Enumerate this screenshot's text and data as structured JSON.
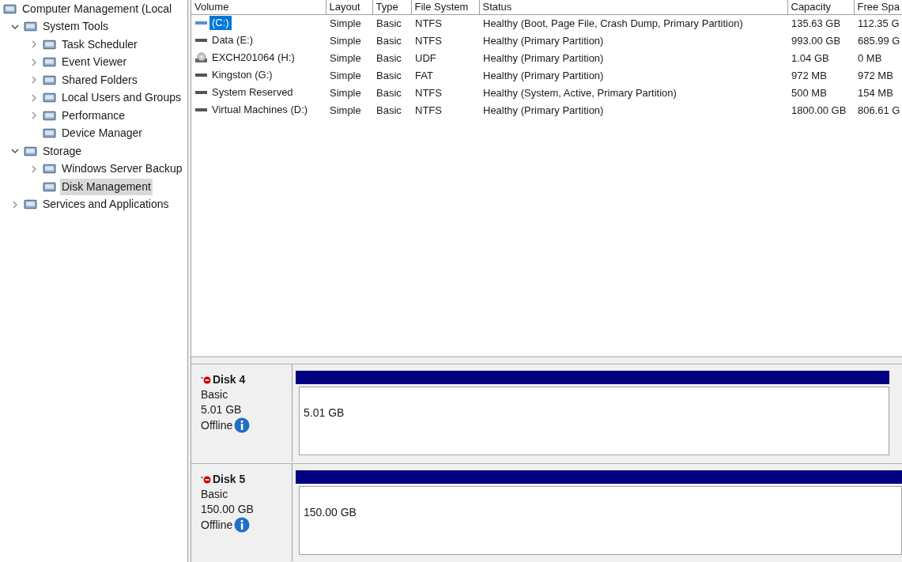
{
  "tree": {
    "label": "Computer Management (Local",
    "children": [
      {
        "label": "System Tools",
        "expanded": true,
        "selected": false,
        "children": [
          {
            "label": "Task Scheduler",
            "expanded": false,
            "selected": false
          },
          {
            "label": "Event Viewer",
            "expanded": false,
            "selected": false
          },
          {
            "label": "Shared Folders",
            "expanded": false,
            "selected": false
          },
          {
            "label": "Local Users and Groups",
            "expanded": false,
            "selected": false
          },
          {
            "label": "Performance",
            "expanded": false,
            "selected": false
          },
          {
            "label": "Device Manager",
            "selected": false
          }
        ]
      },
      {
        "label": "Storage",
        "expanded": true,
        "selected": false,
        "children": [
          {
            "label": "Windows Server Backup",
            "expanded": false,
            "selected": false
          },
          {
            "label": "Disk Management",
            "selected": true
          }
        ]
      },
      {
        "label": "Services and Applications",
        "expanded": false,
        "selected": false
      }
    ]
  },
  "table": {
    "columns": [
      "Volume",
      "Layout",
      "Type",
      "File System",
      "Status",
      "Capacity",
      "Free Spa"
    ],
    "rows": [
      {
        "kind": "drive",
        "selected": true,
        "cells": [
          "(C:)",
          "Simple",
          "Basic",
          "NTFS",
          "Healthy (Boot, Page File, Crash Dump, Primary Partition)",
          "135.63 GB",
          "112.35 G"
        ]
      },
      {
        "kind": "drive",
        "selected": false,
        "cells": [
          "Data (E:)",
          "Simple",
          "Basic",
          "NTFS",
          "Healthy (Primary Partition)",
          "993.00 GB",
          "685.99 G"
        ]
      },
      {
        "kind": "disc",
        "selected": false,
        "cells": [
          "EXCH201064 (H:)",
          "Simple",
          "Basic",
          "UDF",
          "Healthy (Primary Partition)",
          "1.04 GB",
          "0 MB"
        ]
      },
      {
        "kind": "drive",
        "selected": false,
        "cells": [
          "Kingston (G:)",
          "Simple",
          "Basic",
          "FAT",
          "Healthy (Primary Partition)",
          "972 MB",
          "972 MB"
        ]
      },
      {
        "kind": "drive",
        "selected": false,
        "cells": [
          "System Reserved",
          "Simple",
          "Basic",
          "NTFS",
          "Healthy (System, Active, Primary Partition)",
          "500 MB",
          "154 MB"
        ]
      },
      {
        "kind": "drive",
        "selected": false,
        "cells": [
          "Virtual Machines (D:)",
          "Simple",
          "Basic",
          "NTFS",
          "Healthy (Primary Partition)",
          "1800.00 GB",
          "806.61 G"
        ]
      }
    ]
  },
  "disks": [
    {
      "name": "Disk 4",
      "type": "Basic",
      "size": "5.01 GB",
      "status": "Offline",
      "partition": "5.01 GB"
    },
    {
      "name": "Disk 5",
      "type": "Basic",
      "size": "150.00 GB",
      "status": "Offline",
      "partition": "150.00 GB"
    }
  ]
}
